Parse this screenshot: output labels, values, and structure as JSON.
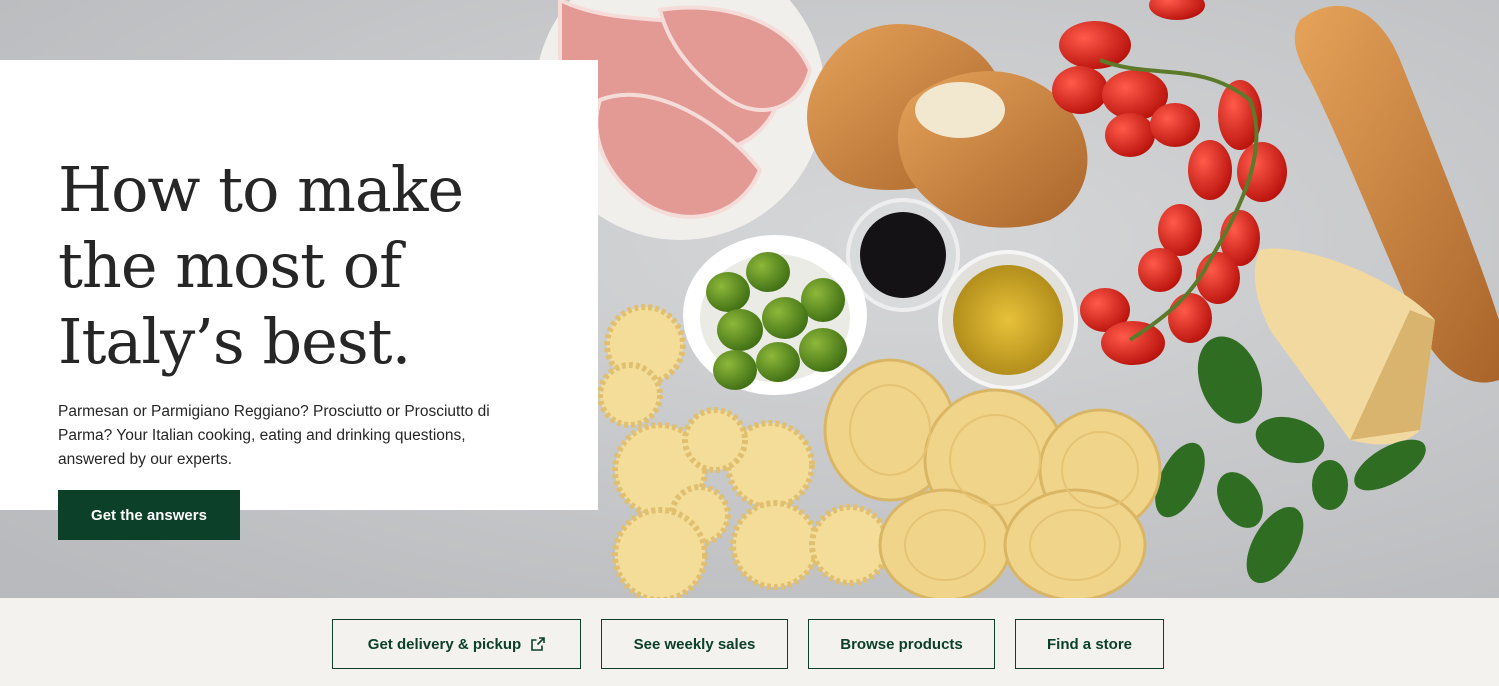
{
  "hero": {
    "title_lines": [
      "How to make",
      "the most of",
      "Italy’s best."
    ],
    "description": "Parmesan or Parmigiano Reggiano? Prosciutto or Prosciutto di Parma? Your Italian cooking, eating and drinking questions, answered by our experts.",
    "cta_label": "Get the answers"
  },
  "quick_links": [
    {
      "label": "Get delivery & pickup",
      "icon": "external-link-icon"
    },
    {
      "label": "See weekly sales"
    },
    {
      "label": "Browse products"
    },
    {
      "label": "Find a store"
    }
  ],
  "colors": {
    "brand_green": "#0c4029",
    "text": "#262626",
    "footer_bg": "#f3f2ee"
  }
}
